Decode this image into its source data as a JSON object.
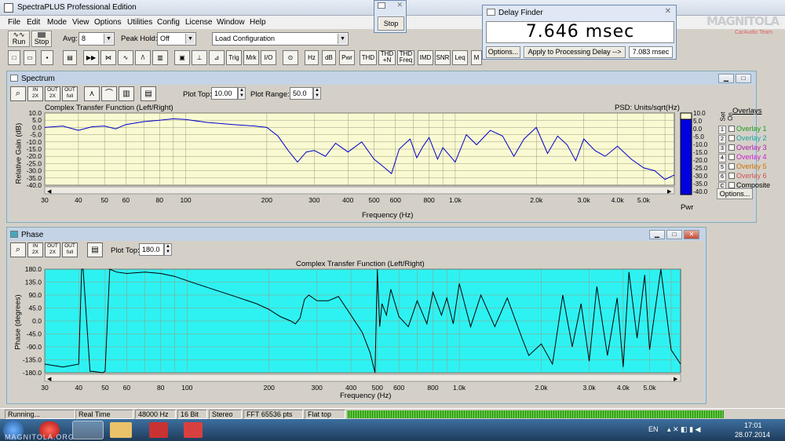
{
  "app": {
    "title": "SpectraPLUS Professional Edition"
  },
  "menu": [
    "File",
    "Edit",
    "Mode",
    "View",
    "Options",
    "Utilities",
    "Config",
    "License",
    "Window",
    "Help"
  ],
  "toolbar": {
    "run": "Run",
    "stop": "Stop",
    "avg_label": "Avg:",
    "avg_value": "8",
    "peak_label": "Peak Hold:",
    "peak_value": "Off",
    "config_value": "Load Configuration"
  },
  "toolbar2": [
    "Trig",
    "Mrk",
    "I/O",
    "Hz",
    "dB",
    "Pwr",
    "THD",
    "THD\n+N",
    "THD\nFreq",
    "IMD",
    "SNR",
    "Leq",
    "M"
  ],
  "stop_window": {
    "button": "Stop"
  },
  "delay": {
    "title": "Delay Finder",
    "value": "7.646 msec",
    "options": "Options...",
    "apply": "Apply to Processing Delay -->",
    "applied_value": "7.083 msec"
  },
  "logo": {
    "text": "MAGNITOLA",
    "sub": "CarAudio Team"
  },
  "spectrum": {
    "title": "Spectrum",
    "plot_top_label": "Plot Top:",
    "plot_top": "10.00",
    "plot_range_label": "Plot Range:",
    "plot_range": "50.0",
    "plot_title": "Complex Transfer Function (Left/Right)",
    "plot_units": "PSD: Units/sqrt(Hz)",
    "ylabel": "Relative Gain (dB)",
    "xlabel": "Frequency (Hz)",
    "pwr": "Pwr",
    "overlays_title": "Overlays",
    "set_label": "Set",
    "on_label": "On",
    "overlays": [
      {
        "n": "1",
        "name": "Overlay 1",
        "color": "#1a9a1a"
      },
      {
        "n": "2",
        "name": "Overlay 2",
        "color": "#1aa6a6"
      },
      {
        "n": "3",
        "name": "Overlay 3",
        "color": "#b020b0"
      },
      {
        "n": "4",
        "name": "Overlay 4",
        "color": "#d020d0"
      },
      {
        "n": "5",
        "name": "Overlay 5",
        "color": "#d07000"
      },
      {
        "n": "6",
        "name": "Overlay 6",
        "color": "#d05050"
      },
      {
        "n": "C",
        "name": "Composite",
        "color": "#000000"
      }
    ],
    "options_btn": "Options..."
  },
  "phase": {
    "title": "Phase",
    "plot_top_label": "Plot Top:",
    "plot_top": "180.0",
    "plot_title": "Complex Transfer Function (Left/Right)",
    "ylabel": "Phase (degrees)",
    "xlabel": "Frequency (Hz)"
  },
  "status": {
    "state": "Running...",
    "mode": "Real Time",
    "rate": "48000 Hz",
    "bits": "16 Bit",
    "channels": "Stereo",
    "fft": "FFT 65536 pts",
    "window": "Flat top"
  },
  "taskbar": {
    "lang": "EN",
    "time": "17:01",
    "date": "28.07.2014",
    "watermark": "MAGNITOLA.ORG"
  },
  "chart_data": [
    {
      "type": "line",
      "title": "Complex Transfer Function (Left/Right)",
      "xlabel": "Frequency (Hz)",
      "ylabel": "Relative Gain (dB)",
      "xscale": "log",
      "xlim": [
        30,
        6500
      ],
      "ylim": [
        -40,
        10
      ],
      "x_ticks": [
        "30",
        "40",
        "50",
        "60",
        "80",
        "100",
        "200",
        "300",
        "400",
        "500",
        "600",
        "800",
        "1.0k",
        "2.0k",
        "3.0k",
        "4.0k",
        "5.0k"
      ],
      "y_ticks": [
        "10.0",
        "5.0",
        "0.0",
        "-5.0",
        "-10.0",
        "-15.0",
        "-20.0",
        "-25.0",
        "-30.0",
        "-35.0",
        "-40.0"
      ],
      "series": [
        {
          "color": "#0000cc",
          "x": [
            30,
            35,
            40,
            45,
            50,
            55,
            60,
            70,
            80,
            90,
            100,
            120,
            150,
            180,
            200,
            220,
            240,
            260,
            280,
            300,
            330,
            360,
            400,
            450,
            500,
            540,
            580,
            620,
            680,
            720,
            760,
            800,
            860,
            900,
            1000,
            1100,
            1200,
            1350,
            1500,
            1650,
            1800,
            2000,
            2200,
            2400,
            2600,
            2800,
            3000,
            3300,
            3600,
            4000,
            4500,
            5000,
            5500,
            6000,
            6500
          ],
          "y": [
            0,
            1,
            -2,
            0.5,
            1,
            -1,
            2,
            4,
            5,
            6,
            5.5,
            3.5,
            2,
            1,
            0,
            -6,
            -16,
            -24,
            -17,
            -16,
            -20,
            -11,
            -17,
            -10,
            -22,
            -27,
            -32,
            -15,
            -8,
            -21,
            -13,
            -7,
            -22,
            -14,
            -24,
            -5,
            -12,
            -2,
            -6,
            -20,
            -8,
            0,
            -18,
            -6,
            -12,
            -23,
            -8,
            -16,
            -20,
            -13,
            -22,
            -28,
            -30,
            -36,
            -33
          ]
        }
      ]
    },
    {
      "type": "line",
      "title": "Complex Transfer Function (Left/Right)",
      "xlabel": "Frequency (Hz)",
      "ylabel": "Phase (degrees)",
      "xscale": "log",
      "xlim": [
        30,
        6500
      ],
      "ylim": [
        -180,
        180
      ],
      "x_ticks": [
        "30",
        "40",
        "50",
        "60",
        "80",
        "100",
        "200",
        "300",
        "400",
        "500",
        "600",
        "800",
        "1.0k",
        "2.0k",
        "3.0k",
        "4.0k",
        "5.0k"
      ],
      "y_ticks": [
        "180.0",
        "135.0",
        "90.0",
        "45.0",
        "0.0",
        "-45.0",
        "-90.0",
        "-135.0",
        "-180.0"
      ],
      "series": [
        {
          "color": "#000000",
          "x": [
            30,
            35,
            40,
            41,
            41.5,
            44,
            45,
            49,
            50,
            52,
            55,
            60,
            70,
            80,
            90,
            100,
            120,
            150,
            180,
            200,
            220,
            240,
            250,
            260,
            270,
            280,
            300,
            330,
            360,
            400,
            440,
            470,
            490,
            500,
            510,
            520,
            540,
            560,
            600,
            650,
            700,
            760,
            800,
            860,
            900,
            950,
            1000,
            1100,
            1200,
            1350,
            1500,
            1700,
            1800,
            2000,
            2200,
            2400,
            2600,
            2800,
            3000,
            3200,
            3500,
            3800,
            4000,
            4200,
            4500,
            4800,
            5000,
            5500,
            6000,
            6500
          ],
          "y": [
            -150,
            -160,
            -150,
            180,
            180,
            -175,
            -175,
            -180,
            -175,
            180,
            170,
            165,
            170,
            165,
            155,
            140,
            115,
            85,
            60,
            40,
            15,
            0,
            -10,
            10,
            75,
            90,
            70,
            70,
            85,
            20,
            -40,
            -110,
            -180,
            180,
            -20,
            60,
            20,
            110,
            15,
            -20,
            70,
            -10,
            100,
            20,
            80,
            -10,
            130,
            -20,
            90,
            -20,
            80,
            -60,
            -120,
            -80,
            -150,
            90,
            -90,
            60,
            -140,
            120,
            -120,
            80,
            -160,
            170,
            -60,
            160,
            -100,
            180,
            -100,
            -150
          ]
        }
      ]
    }
  ]
}
